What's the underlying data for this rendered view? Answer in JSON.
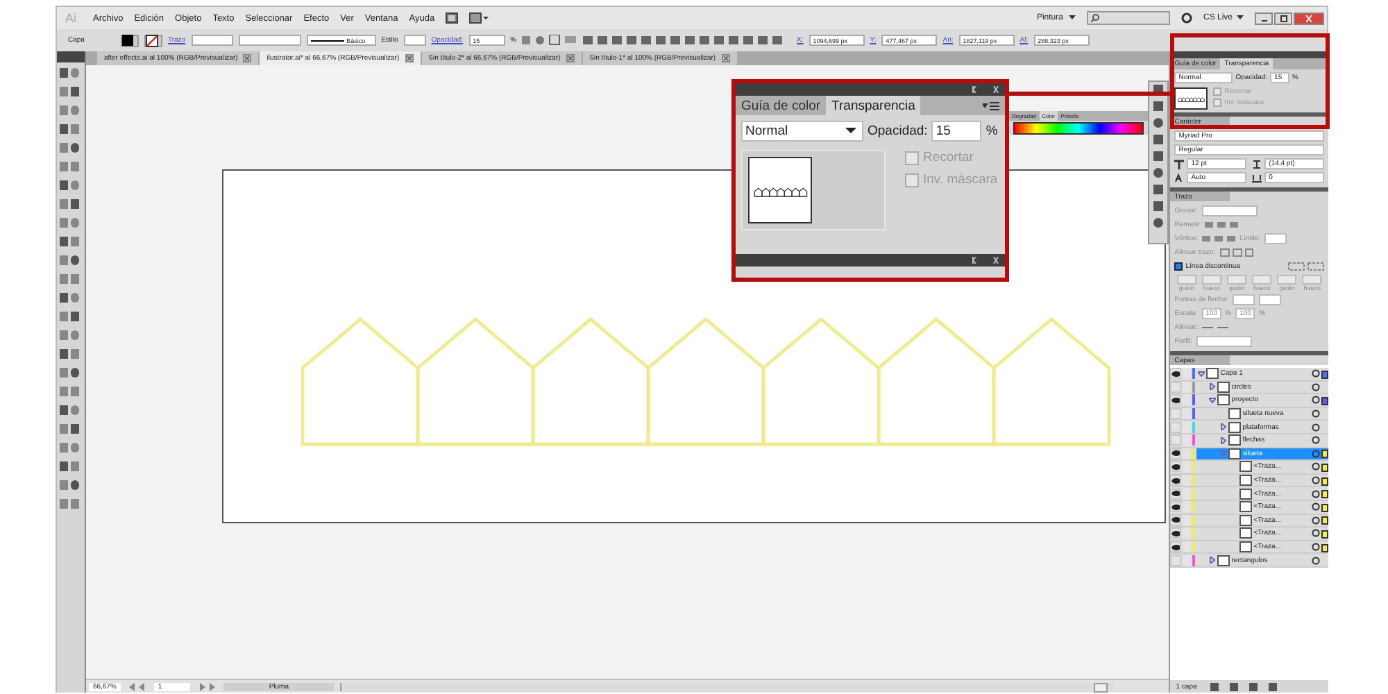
{
  "menu_bar": {
    "logo": "Ai",
    "items": [
      "Archivo",
      "Edición",
      "Objeto",
      "Texto",
      "Seleccionar",
      "Efecto",
      "Ver",
      "Ventana",
      "Ayuda"
    ],
    "workspace": "Pintura",
    "cs_live": "CS Live"
  },
  "control_bar": {
    "object_label": "Capa",
    "stroke_label": "Trazo",
    "brush": "Básico",
    "style_label": "Estilo",
    "opacity_label": "Opacidad:",
    "opacity": "15",
    "percent": "%",
    "fields": [
      {
        "label": "X:",
        "value": "1094,699 px"
      },
      {
        "label": "Y:",
        "value": "477,467 px"
      },
      {
        "label": "An:",
        "value": "1827,119 px"
      },
      {
        "label": "Al:",
        "value": "288,323 px"
      }
    ]
  },
  "document_tabs": [
    {
      "label": "after effects.ai al 100% (RGB/Previsualizar)",
      "selected": false
    },
    {
      "label": "ilustrator.ai* al 66,67% (RGB/Previsualizar)",
      "selected": true
    },
    {
      "label": "Sin título-2* al 66,67% (RGB/Previsualizar)",
      "selected": false
    },
    {
      "label": "Sin título-1* al 100% (RGB/Previsualizar)",
      "selected": false
    }
  ],
  "transparency_callout": {
    "tabs": [
      {
        "label": "Guía de color",
        "selected": false
      },
      {
        "label": "Transparencia",
        "selected": true
      }
    ],
    "mode": "Normal",
    "opacity_label": "Opacidad:",
    "opacity": "15",
    "percent": "%",
    "options": [
      {
        "label": "Recortar",
        "checked": false,
        "disabled": true
      },
      {
        "label": "Inv. máscara",
        "checked": false,
        "disabled": true
      }
    ]
  },
  "color_panel": {
    "tabs": [
      {
        "label": "Degradad",
        "selected": false
      },
      {
        "label": "Color",
        "selected": true
      },
      {
        "label": "Pincelo",
        "selected": false
      }
    ]
  },
  "transparency_panel": {
    "tabs": [
      {
        "label": "Guía de color",
        "selected": false
      },
      {
        "label": "Transparencia",
        "selected": true
      }
    ],
    "mode": "Normal",
    "opacity_label": "Opacidad:",
    "opacity": "15",
    "percent": "%",
    "options": [
      {
        "label": "Recortar",
        "checked": false,
        "disabled": true
      },
      {
        "label": "Inv. máscara",
        "checked": false,
        "disabled": true
      }
    ]
  },
  "character_panel": {
    "title": "Carácter",
    "font": "Myriad Pro",
    "style": "Regular",
    "size": "12 pt",
    "leading": "(14,4 pt)",
    "kerning": "Auto",
    "tracking": "0"
  },
  "stroke_panel": {
    "title": "Trazo",
    "weight_label": "Grosor:",
    "cap_label": "Remate:",
    "corner_label": "Vértice:",
    "limit_label": "Límite:",
    "align_label": "Alinear trazo:",
    "dashed": {
      "label": "Línea discontinua",
      "checked": true
    },
    "dash_labels": [
      "guión",
      "hueco",
      "guión",
      "hueco",
      "guión",
      "hueco"
    ],
    "arrowheads_label": "Puntas de flecha:",
    "scale_label": "Escala:",
    "scale_values": [
      {
        "value": "100",
        "unit": "%"
      },
      {
        "value": "100",
        "unit": "%"
      }
    ],
    "arrow_align_label": "Alinear:",
    "profile_label": "Perfil:"
  },
  "layers_panel": {
    "title": "Capas",
    "layers": [
      {
        "name": "Capa 1",
        "visible": true,
        "color": "#4f6cff",
        "selected": false,
        "art_selected": true,
        "expanded": true,
        "children": [
          {
            "name": "circles",
            "visible": false,
            "color": "#9a9a9a",
            "selected": false,
            "art_selected": false,
            "expanded": false
          },
          {
            "name": "proyecto",
            "visible": true,
            "color": "#5b5bff",
            "selected": false,
            "art_selected": true,
            "expanded": true,
            "children": [
              {
                "name": "silueta nueva",
                "visible": false,
                "color": "#5b5bff",
                "selected": false,
                "art_selected": false
              },
              {
                "name": "plataformas",
                "visible": false,
                "color": "#33e0e0",
                "selected": false,
                "art_selected": false,
                "expanded": false
              },
              {
                "name": "flechas",
                "visible": false,
                "color": "#ff4fd8",
                "selected": false,
                "art_selected": false,
                "expanded": false
              },
              {
                "name": "silueta",
                "visible": true,
                "color": "#f2ee4a",
                "selected": true,
                "art_selected": true,
                "expanded": true,
                "children": [
                  {
                    "name": "<Traza...",
                    "visible": true,
                    "color": "#f2ee4a",
                    "selected": false,
                    "art_selected": true
                  },
                  {
                    "name": "<Traza...",
                    "visible": true,
                    "color": "#f2ee4a",
                    "selected": false,
                    "art_selected": true
                  },
                  {
                    "name": "<Traza...",
                    "visible": true,
                    "color": "#f2ee4a",
                    "selected": false,
                    "art_selected": true
                  },
                  {
                    "name": "<Traza...",
                    "visible": true,
                    "color": "#f2ee4a",
                    "selected": false,
                    "art_selected": true
                  },
                  {
                    "name": "<Traza...",
                    "visible": true,
                    "color": "#f2ee4a",
                    "selected": false,
                    "art_selected": true
                  },
                  {
                    "name": "<Traza...",
                    "visible": true,
                    "color": "#f2ee4a",
                    "selected": false,
                    "art_selected": true
                  },
                  {
                    "name": "<Traza...",
                    "visible": true,
                    "color": "#f2ee4a",
                    "selected": false,
                    "art_selected": true
                  }
                ]
              }
            ]
          },
          {
            "name": "rectangulos",
            "visible": false,
            "color": "#ff4fd8",
            "selected": false,
            "art_selected": false,
            "expanded": false
          }
        ]
      }
    ],
    "footer": "1 capa"
  },
  "status_bar": {
    "zoom": "66,67%",
    "artboard": "1",
    "tool": "Pluma"
  }
}
